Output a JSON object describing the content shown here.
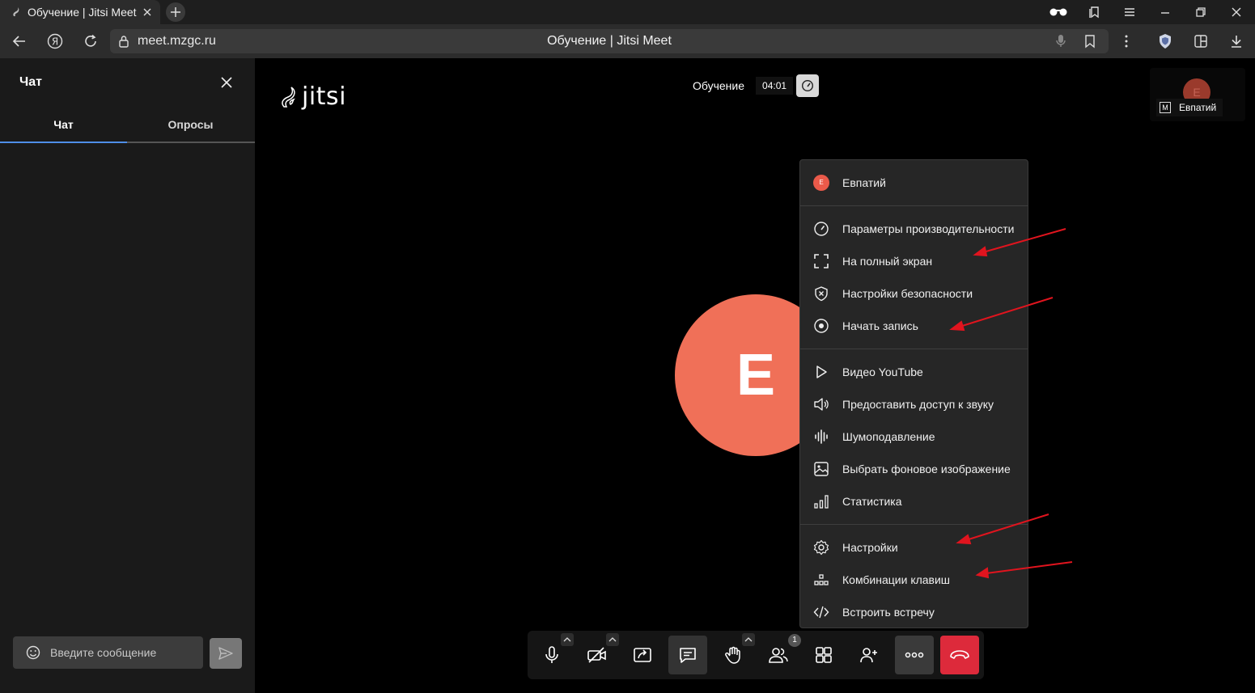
{
  "browser": {
    "tab_title": "Обучение | Jitsi Meet",
    "url": "meet.mzgc.ru",
    "page_title": "Обучение | Jitsi Meet"
  },
  "chat": {
    "title": "Чат",
    "tabs": [
      {
        "label": "Чат",
        "active": true
      },
      {
        "label": "Опросы",
        "active": false
      }
    ],
    "input_placeholder": "Введите сообщение"
  },
  "meeting": {
    "logo_text": "jitsi",
    "subject": "Обучение",
    "timer": "04:01",
    "participant_name": "Евпатий",
    "participant_initial": "E",
    "moderator_badge": "M",
    "participant_count": "1"
  },
  "menu": {
    "profile_name": "Евпатий",
    "profile_initial": "E",
    "groups": [
      [
        {
          "label": "Параметры производительности",
          "icon": "gauge-icon"
        },
        {
          "label": "На полный экран",
          "icon": "fullscreen-icon"
        },
        {
          "label": "Настройки безопасности",
          "icon": "shield-icon"
        },
        {
          "label": "Начать запись",
          "icon": "record-icon"
        }
      ],
      [
        {
          "label": "Видео YouTube",
          "icon": "play-icon"
        },
        {
          "label": "Предоставить доступ к звуку",
          "icon": "speaker-icon"
        },
        {
          "label": "Шумоподавление",
          "icon": "waveform-icon"
        },
        {
          "label": "Выбрать фоновое изображение",
          "icon": "image-icon"
        },
        {
          "label": "Статистика",
          "icon": "stats-icon"
        }
      ],
      [
        {
          "label": "Настройки",
          "icon": "gear-icon"
        },
        {
          "label": "Комбинации клавиш",
          "icon": "shortcuts-icon"
        },
        {
          "label": "Встроить встречу",
          "icon": "code-icon"
        }
      ]
    ]
  },
  "colors": {
    "avatar": "#f07058",
    "hangup": "#dd2a3b",
    "annotation_arrow": "#e0141e",
    "active_tab": "#4f8ee8"
  }
}
